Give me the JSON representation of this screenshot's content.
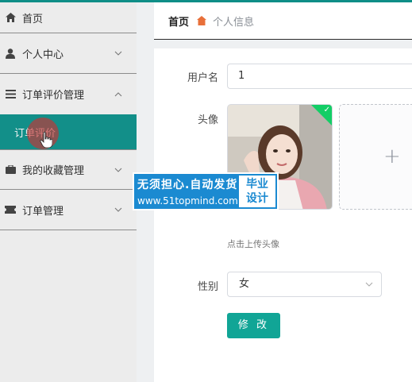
{
  "sidebar": {
    "items": [
      {
        "label": "首页",
        "icon": "home-icon",
        "has_chevron": false
      },
      {
        "label": "个人中心",
        "icon": "user-icon",
        "has_chevron": true,
        "expanded": false
      },
      {
        "label": "订单评价管理",
        "icon": "list-icon",
        "has_chevron": true,
        "expanded": true,
        "children": [
          {
            "label": "订单评价",
            "active": true
          }
        ]
      },
      {
        "label": "我的收藏管理",
        "icon": "briefcase-icon",
        "has_chevron": true,
        "expanded": false
      },
      {
        "label": "订单管理",
        "icon": "ticket-icon",
        "has_chevron": true,
        "expanded": false
      }
    ]
  },
  "breadcrumb": {
    "home": "首页",
    "current": "个人信息"
  },
  "form": {
    "username_label": "用户名",
    "username_value": "1",
    "avatar_label": "头像",
    "upload_hint": "点击上传头像",
    "gender_label": "性别",
    "gender_value": "女",
    "submit_label": "修 改"
  },
  "watermark": {
    "line1": "无须担心.自动发货",
    "line2": "www.51topmind.com",
    "badge_line1": "毕业",
    "badge_line2": "设计"
  },
  "colors": {
    "accent": "#0f8e87",
    "submit": "#11a596",
    "upload_success": "#13ce66",
    "watermark": "#1b8ad1"
  }
}
